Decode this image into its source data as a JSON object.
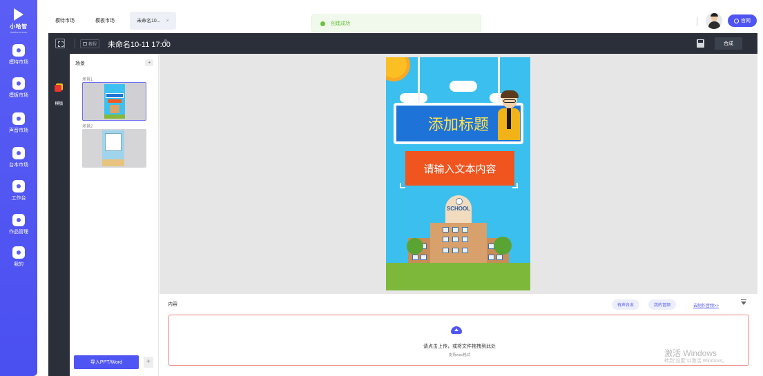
{
  "sidebar": {
    "logo_text": "小哈智",
    "logo_sub": "xiaoha.ai.com",
    "items": [
      {
        "label": "模特市场"
      },
      {
        "label": "模板市场"
      },
      {
        "label": "声音市场"
      },
      {
        "label": "台本市场"
      },
      {
        "label": "工作台"
      },
      {
        "label": "作品管理"
      },
      {
        "label": "我的"
      }
    ]
  },
  "tabs": [
    {
      "label": "模特市场"
    },
    {
      "label": "模板市场"
    },
    {
      "label": "未命名10...",
      "close": "×"
    }
  ],
  "toast": {
    "text": "创建成功",
    "color": "#67c23a"
  },
  "header": {
    "official_label": "官网",
    "tutorial_label": "教程",
    "doc_title": "未命名10-11 17:00",
    "compose_label": "合成"
  },
  "template_strip": {
    "label": "模板"
  },
  "scenes": {
    "title": "场景",
    "items": [
      {
        "label": "场景1"
      },
      {
        "label": "场景2"
      }
    ],
    "import_label": "导入PPT/Word",
    "add_label": "+"
  },
  "poster": {
    "title": "添加标题",
    "body": "请输入文本内容",
    "school_sign": "SCHOOL"
  },
  "content_panel": {
    "title": "内容",
    "pill_1": "有声台本",
    "pill_2": "我的音频",
    "link": "去制作音频>>",
    "upload_text": "请点击上传，或将文件拖拽到此处",
    "upload_sub": "支持wav格式",
    "watermark": "激活 Windows",
    "watermark_sub": "转到“设置”以激活 Windows。"
  },
  "colors": {
    "accent": "#4f55f2",
    "dark": "#2b2f3a",
    "poster_bg": "#3bbfee",
    "title_board": "#1e73d9",
    "text_box": "#f0541f"
  }
}
